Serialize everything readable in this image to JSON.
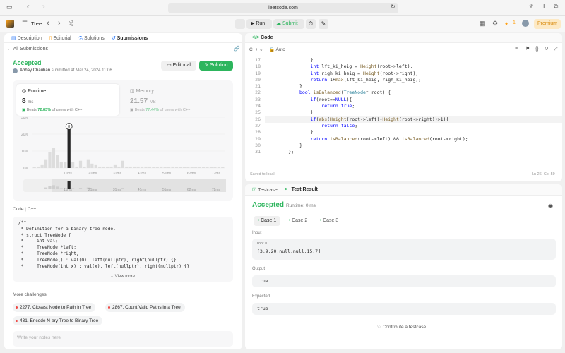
{
  "browser": {
    "url": "leetcode.com"
  },
  "app": {
    "problem_list": "Tree",
    "run": "Run",
    "submit": "Submit",
    "streak": "1",
    "premium": "Premium"
  },
  "left_tabs": [
    "Description",
    "Editorial",
    "Solutions",
    "Submissions"
  ],
  "submission": {
    "back": "All Submissions",
    "status": "Accepted",
    "user": "Abhay Chauhan",
    "submitted": "submitted at Mar 24, 2024 11:06",
    "editorial_btn": "Editorial",
    "solution_btn": "Solution"
  },
  "runtime": {
    "label": "Runtime",
    "value": "8",
    "unit": "ms",
    "beats_prefix": "Beats",
    "beats": "72.83%",
    "beats_suffix": "of users with C++"
  },
  "memory": {
    "label": "Memory",
    "value": "21.57",
    "unit": "MB",
    "beats_prefix": "Beats",
    "beats": "77.44%",
    "beats_suffix": "of users with C++"
  },
  "chart_data": {
    "type": "bar",
    "yticks": [
      "30%",
      "20%",
      "10%",
      "0%"
    ],
    "xticks": [
      "11ms",
      "21ms",
      "31ms",
      "41ms",
      "51ms",
      "62ms",
      "72ms"
    ],
    "highlight_value": "8",
    "values": [
      0.5,
      1,
      2,
      6,
      11,
      14,
      9,
      4,
      4,
      30,
      4,
      1,
      5,
      1,
      6,
      3,
      2,
      1,
      1,
      1,
      1,
      2,
      1,
      5,
      1,
      1,
      1,
      1,
      1,
      1,
      1,
      0.5,
      0.5,
      1,
      0.5,
      0.5,
      1,
      0.5,
      0.5,
      0.5,
      0.5,
      0.5,
      0.5,
      0.5,
      0.5,
      0.5,
      0.5,
      0.5,
      0.5,
      0.5
    ],
    "ylim": [
      0,
      35
    ]
  },
  "code_section": {
    "label": "Code",
    "lang": "C++",
    "view_more": "View more"
  },
  "code_preview": [
    "/**",
    " * Definition for a binary tree node.",
    " * struct TreeNode {",
    " *     int val;",
    " *     TreeNode *left;",
    " *     TreeNode *right;",
    " *     TreeNode() : val(0), left(nullptr), right(nullptr) {}",
    " *     TreeNode(int x) : val(x), left(nullptr), right(nullptr) {}"
  ],
  "more_challenges": {
    "label": "More challenges",
    "items": [
      "2277. Closest Node to Path in Tree",
      "2867. Count Valid Paths in a Tree",
      "431. Encode N-ary Tree to Binary Tree"
    ]
  },
  "notes_placeholder": "Write your notes here",
  "editor": {
    "title": "Code",
    "lang": "C++",
    "mode": "Auto",
    "saved": "Saved to local",
    "cursor": "Ln 26, Col 59",
    "line_numbers": [
      "17",
      "18",
      "19",
      "20",
      "21",
      "22",
      "23",
      "24",
      "25",
      "26",
      "27",
      "28",
      "29",
      "30",
      "31"
    ]
  },
  "result": {
    "tab_testcase": "Testcase",
    "tab_result": "Test Result",
    "status": "Accepted",
    "runtime": "Runtime: 0 ms",
    "cases": [
      "Case 1",
      "Case 2",
      "Case 3"
    ],
    "input_label": "Input",
    "input_name": "root =",
    "input_value": "[3,9,20,null,null,15,7]",
    "output_label": "Output",
    "output_value": "true",
    "expected_label": "Expected",
    "expected_value": "true",
    "contribute": "Contribute a testcase"
  }
}
